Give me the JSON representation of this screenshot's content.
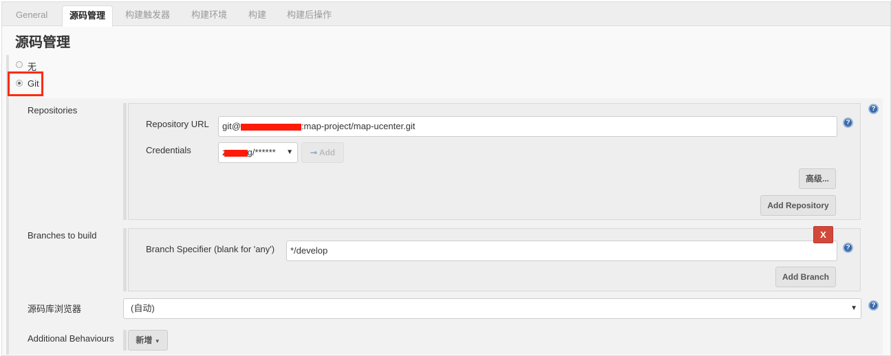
{
  "tabs": [
    {
      "label": "General"
    },
    {
      "label": "源码管理",
      "active": true
    },
    {
      "label": "构建触发器"
    },
    {
      "label": "构建环境"
    },
    {
      "label": "构建"
    },
    {
      "label": "构建后操作"
    }
  ],
  "section_title": "源码管理",
  "scm_options": [
    {
      "label": "无",
      "selected": false
    },
    {
      "label": "Git",
      "selected": true
    }
  ],
  "repositories": {
    "label": "Repositories",
    "url_label": "Repository URL",
    "url_prefix": "git@",
    "url_suffix": ":map-project/map-ucenter.git",
    "credentials_label": "Credentials",
    "credentials_suffix": "g/******",
    "credentials_prefix": "z",
    "add_label": "Add",
    "advanced_label": "高级...",
    "add_repository_label": "Add Repository"
  },
  "branches": {
    "label": "Branches to build",
    "specifier_label": "Branch Specifier (blank for 'any')",
    "specifier_value": "*/develop",
    "delete_label": "X",
    "add_branch_label": "Add Branch"
  },
  "browser": {
    "label": "源码库浏览器",
    "value": "(自动)"
  },
  "behaviours": {
    "label": "Additional Behaviours",
    "add_label": "新增"
  },
  "help_icon": "?",
  "colors": {
    "highlight": "#ff2a0c",
    "delete": "#d24939",
    "help": "#3a6aa8"
  }
}
